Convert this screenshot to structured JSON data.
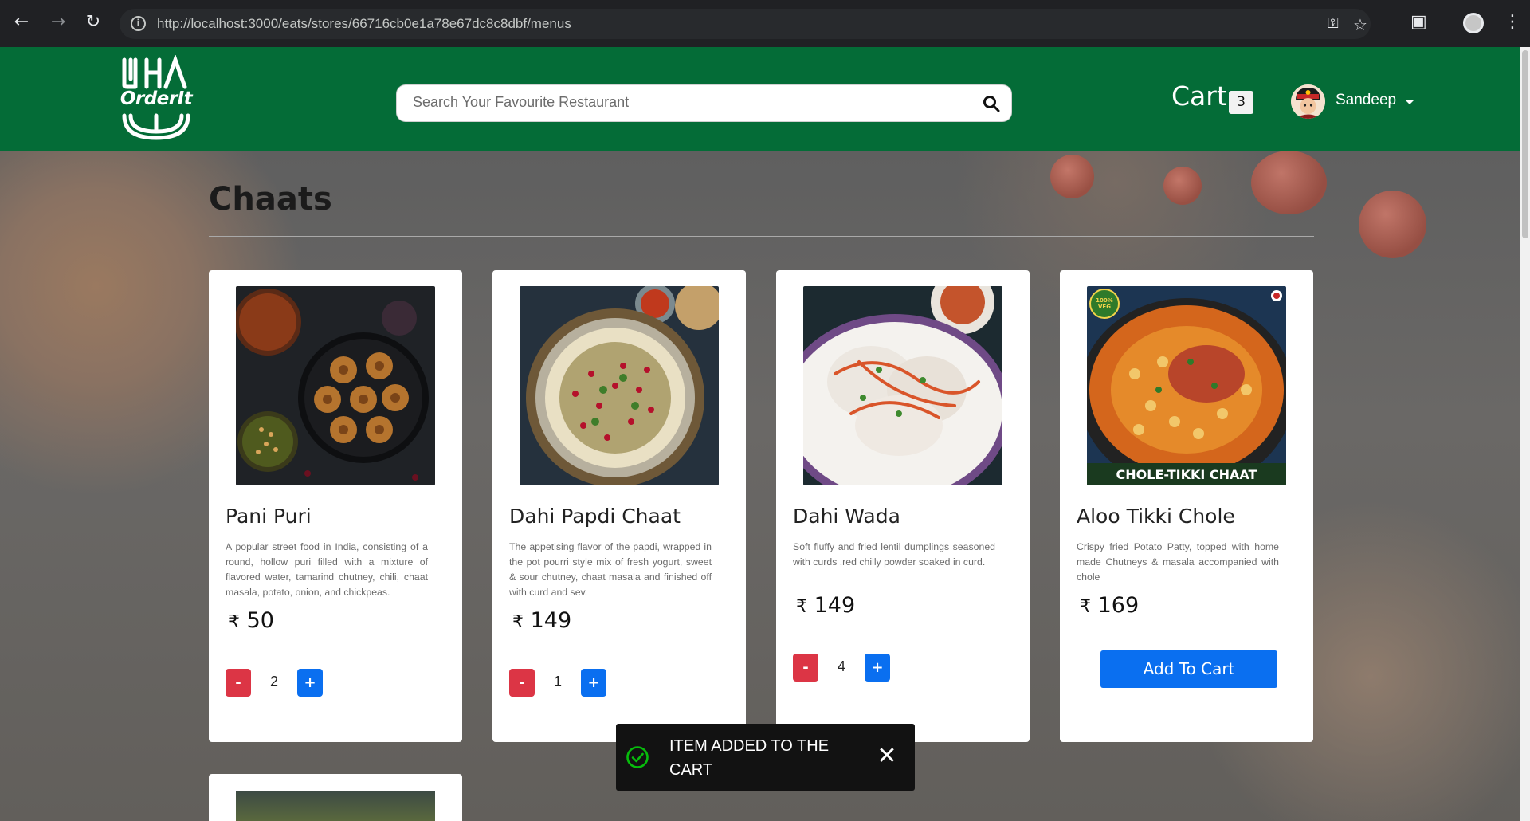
{
  "browser": {
    "url": "http://localhost:3000/eats/stores/66716cb0e1a78e67dc8c8dbf/menus"
  },
  "header": {
    "logo_text": "OrderIt",
    "search_placeholder": "Search Your Favourite Restaurant",
    "cart_label": "Cart",
    "cart_count": "3",
    "user_name": "Sandeep"
  },
  "section": {
    "title": "Chaats"
  },
  "items": [
    {
      "name": "Pani Puri",
      "description": "A popular street food in India, consisting of a round, hollow puri filled with a mixture of flavored water, tamarind chutney, chili, chaat masala, potato, onion, and chickpeas.",
      "currency": "₹",
      "price": "50",
      "quantity": "2"
    },
    {
      "name": "Dahi Papdi Chaat",
      "description": "The appetising flavor of the papdi, wrapped in the pot pourri style mix of fresh yogurt, sweet & sour chutney, chaat masala and finished off with curd and sev.",
      "currency": "₹",
      "price": "149",
      "quantity": "1"
    },
    {
      "name": "Dahi Wada",
      "description": "Soft fluffy and fried lentil dumplings seasoned with curds ,red chilly powder soaked in curd.",
      "currency": "₹",
      "price": "149",
      "quantity": "4"
    },
    {
      "name": "Aloo Tikki Chole",
      "description": "Crispy fried Potato Patty, topped with home made Chutneys & masala accompanied with chole",
      "currency": "₹",
      "price": "169",
      "add_label": "Add To Cart",
      "image_caption": "CHOLE-TIKKI CHAAT",
      "image_badge": "100% VEGETARIAN"
    }
  ],
  "stepper": {
    "minus": "-",
    "plus": "+"
  },
  "toast": {
    "message": "ITEM ADDED TO THE CART"
  },
  "colors": {
    "header_green": "#046c37",
    "button_blue": "#0a6ff0",
    "button_red": "#dc3545",
    "toast_bg": "#121212",
    "toast_check": "#07bc0c"
  }
}
